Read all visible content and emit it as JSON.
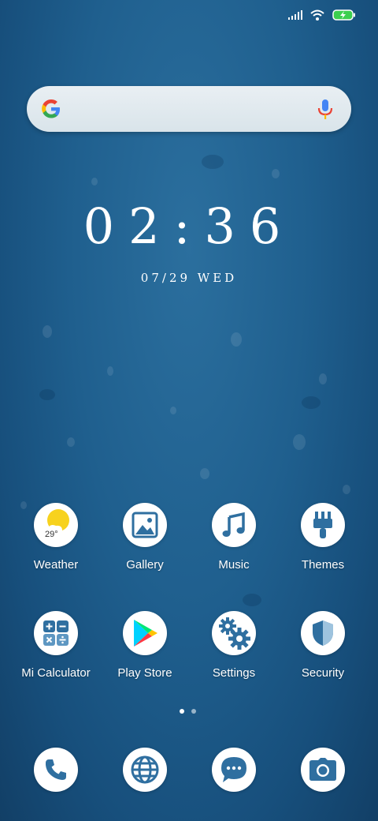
{
  "status_bar": {
    "signal_icon": "signal-icon",
    "wifi_icon": "wifi-icon",
    "battery_icon": "battery-charging-icon",
    "battery_color": "#3ccf4e"
  },
  "search": {
    "logo_icon": "google-logo-icon",
    "mic_icon": "microphone-icon"
  },
  "clock": {
    "time": "02:36",
    "date": "07/29 WED"
  },
  "apps": [
    {
      "label": "Weather",
      "icon": "weather-icon",
      "temp": "29°"
    },
    {
      "label": "Gallery",
      "icon": "gallery-icon"
    },
    {
      "label": "Music",
      "icon": "music-icon"
    },
    {
      "label": "Themes",
      "icon": "themes-icon"
    },
    {
      "label": "Mi Calculator",
      "icon": "calculator-icon"
    },
    {
      "label": "Play Store",
      "icon": "play-store-icon"
    },
    {
      "label": "Settings",
      "icon": "settings-icon"
    },
    {
      "label": "Security",
      "icon": "security-icon"
    }
  ],
  "pages": {
    "count": 2,
    "current": 1
  },
  "dock": [
    {
      "icon": "phone-icon"
    },
    {
      "icon": "browser-icon"
    },
    {
      "icon": "messages-icon"
    },
    {
      "icon": "camera-icon"
    }
  ],
  "colors": {
    "icon_blue": "#2f6fa0",
    "wallpaper": "#1f5f8e"
  }
}
